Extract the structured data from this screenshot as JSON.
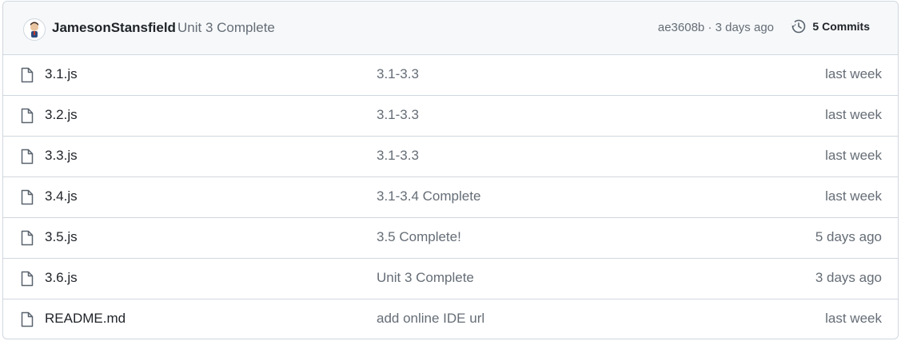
{
  "commit_header": {
    "author": "JamesonStansfield",
    "message": "Unit 3 Complete",
    "hash": "ae3608b",
    "separator": "·",
    "age": "3 days ago",
    "commits_label": "5 Commits",
    "commits_icon": "history-icon"
  },
  "files": [
    {
      "name": "3.1.js",
      "message": "3.1-3.3",
      "date": "last week",
      "icon": "file-icon"
    },
    {
      "name": "3.2.js",
      "message": "3.1-3.3",
      "date": "last week",
      "icon": "file-icon"
    },
    {
      "name": "3.3.js",
      "message": "3.1-3.3",
      "date": "last week",
      "icon": "file-icon"
    },
    {
      "name": "3.4.js",
      "message": "3.1-3.4 Complete",
      "date": "last week",
      "icon": "file-icon"
    },
    {
      "name": "3.5.js",
      "message": "3.5 Complete!",
      "date": "5 days ago",
      "icon": "file-icon"
    },
    {
      "name": "3.6.js",
      "message": "Unit 3 Complete",
      "date": "3 days ago",
      "icon": "file-icon"
    },
    {
      "name": "README.md",
      "message": "add online IDE url",
      "date": "last week",
      "icon": "file-icon"
    }
  ],
  "colors": {
    "border": "#d0d7de",
    "header_bg": "#f6f8fa",
    "text": "#1f2328",
    "muted": "#656d76"
  }
}
